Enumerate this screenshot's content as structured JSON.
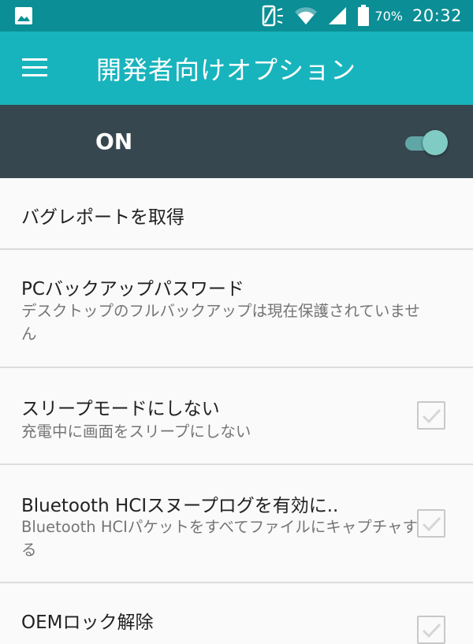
{
  "status_bar": {
    "battery_percent": "70%",
    "time": "20:32",
    "icons": [
      "image-icon",
      "vibrate-icon",
      "wifi-icon",
      "signal-icon",
      "battery-icon"
    ]
  },
  "app_bar": {
    "title": "開発者向けオプション",
    "menu_icon": "hamburger-menu-icon"
  },
  "master_switch": {
    "label": "ON",
    "state": "on"
  },
  "settings": [
    {
      "title": "バグレポートを取得"
    },
    {
      "title": "PCバックアップパスワード",
      "summary": "デスクトップのフルバックアップは現在保護されていません"
    },
    {
      "title": "スリープモードにしない",
      "summary": "充電中に画面をスリープにしない",
      "checked": false
    },
    {
      "title": "Bluetooth HCIスヌープログを有効に..",
      "summary": "Bluetooth HCIパケットをすべてファイルにキャプチャする",
      "checked": false
    },
    {
      "title": "OEMロック解除",
      "checked": false
    }
  ],
  "colors": {
    "status_bar": "#0b8e95",
    "app_bar": "#18b4bd",
    "master_bar": "#37474f",
    "switch_thumb": "#80cbc4"
  }
}
